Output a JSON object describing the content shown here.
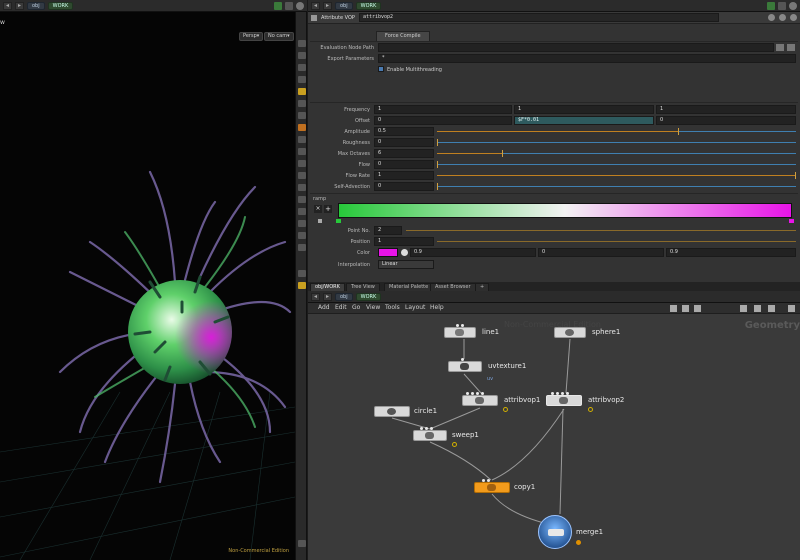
{
  "left_pane": {
    "path": "obj",
    "network": "WORK",
    "side_label": "w",
    "btn_persp": "Persp▾",
    "btn_cam": "No cam▾",
    "watermark": "Non-Commercial Edition"
  },
  "right_pathbar": {
    "path": "obj",
    "network": "WORK"
  },
  "parameters": {
    "node_type": "Attribute VOP",
    "node_name": "attribvop2",
    "tab_label": "Force Compile",
    "evaluation_label": "Evaluation Node Path",
    "export_label": "Export Parameters",
    "export_value": "*",
    "multithread_label": "Enable Multithreading",
    "rows": [
      {
        "label": "Frequency",
        "values": [
          "1",
          "1",
          "1"
        ]
      },
      {
        "label": "Offset",
        "values": [
          "0",
          "$F*0.01",
          "0"
        ]
      },
      {
        "label": "Amplitude",
        "value": "0.5",
        "level": 0.67
      },
      {
        "label": "Roughness",
        "value": "0",
        "level": 0
      },
      {
        "label": "Max Octaves",
        "value": "6",
        "level": 0.18
      },
      {
        "label": "Flow",
        "value": "0",
        "level": 0
      },
      {
        "label": "Flow Rate",
        "value": "1",
        "level": 1
      },
      {
        "label": "Self-Advection",
        "value": "0",
        "level": 0
      }
    ],
    "ramp_label": "ramp",
    "ramp_colors": [
      "#27c93a",
      "#e814e8"
    ],
    "point_no_label": "Point No.",
    "point_no_value": "2",
    "position_label": "Position",
    "position_value": "1",
    "color_label": "Color",
    "color_swatch": "#e814e8",
    "color_values": [
      "0.9",
      "0",
      "0.9"
    ],
    "interp_label": "Interpolation",
    "interp_value": "Linear"
  },
  "pane_tabs": [
    "obj/WORK",
    "Tree View",
    "Material Palette",
    "Asset Browser",
    "+"
  ],
  "network": {
    "path": "obj",
    "network": "WORK",
    "menus": [
      "Add",
      "Edit",
      "Go",
      "View",
      "Tools",
      "Layout",
      "Help"
    ],
    "context_label": "Geometry",
    "faded_label": "Non-Commercial Edition",
    "nodes": [
      {
        "name": "line1"
      },
      {
        "name": "sphere1"
      },
      {
        "name": "uvtexture1",
        "sub": "uv"
      },
      {
        "name": "attribvop1"
      },
      {
        "name": "attribvop2"
      },
      {
        "name": "circle1"
      },
      {
        "name": "sweep1"
      },
      {
        "name": "copy1"
      },
      {
        "name": "merge1"
      }
    ]
  }
}
